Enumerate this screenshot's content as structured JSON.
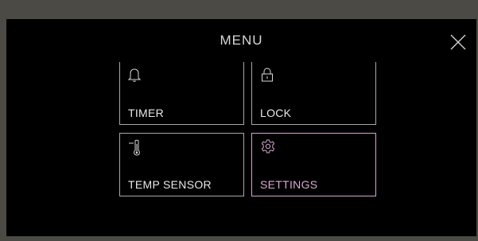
{
  "menu": {
    "title": "MENU",
    "close_icon": "close-icon",
    "tiles": [
      {
        "label": "TIMER",
        "icon": "bell-icon",
        "active": false
      },
      {
        "label": "LOCK",
        "icon": "lock-icon",
        "active": false
      },
      {
        "label": "TEMP SENSOR",
        "icon": "thermometer-icon",
        "active": false
      },
      {
        "label": "SETTINGS",
        "icon": "gear-icon",
        "active": true
      }
    ]
  },
  "colors": {
    "background": "#000000",
    "bezel": "#4b4a44",
    "tile_border": "#a7a7a7",
    "active_accent": "#d4a5ce",
    "text": "#e9e9e9"
  }
}
